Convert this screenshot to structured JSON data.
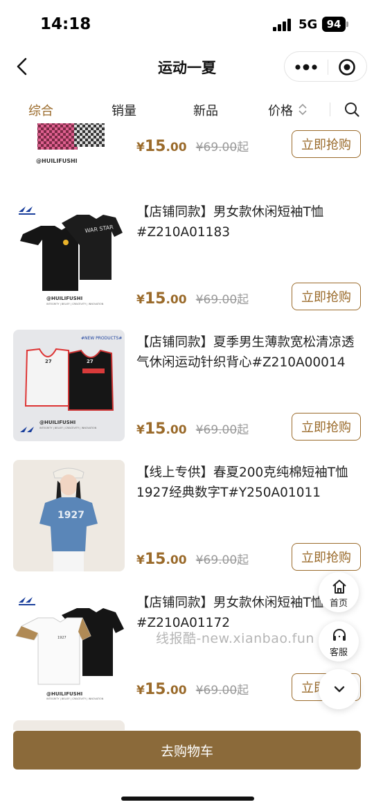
{
  "status_bar": {
    "time": "14:18",
    "network": "5G",
    "battery": "94"
  },
  "nav": {
    "title": "运动一夏"
  },
  "tabs": [
    {
      "label": "综合",
      "active": true
    },
    {
      "label": "销量",
      "active": false
    },
    {
      "label": "新品",
      "active": false
    },
    {
      "label": "价格",
      "active": false
    }
  ],
  "thumb_text": {
    "brand": "@HUILIFUSHI",
    "tagline": "INTEGRITY | BELIEF | CREATIVITY | INNOVATION",
    "new_products": "#NEW PRODUCTS#",
    "jersey_no": "27",
    "shirt_print": "1927"
  },
  "products": [
    {
      "title": "",
      "price_currency": "¥",
      "price_int": "15",
      "price_dec": ".00",
      "original_price": "¥69.00",
      "from_label": "起",
      "buy_label": "立即抢购"
    },
    {
      "title": "【店铺同款】男女款休闲短袖T恤#Z210A01183",
      "price_currency": "¥",
      "price_int": "15",
      "price_dec": ".00",
      "original_price": "¥69.00",
      "from_label": "起",
      "buy_label": "立即抢购"
    },
    {
      "title": "【店铺同款】夏季男生薄款宽松清凉透气休闲运动针织背心#Z210A00014",
      "price_currency": "¥",
      "price_int": "15",
      "price_dec": ".00",
      "original_price": "¥69.00",
      "from_label": "起",
      "buy_label": "立即抢购"
    },
    {
      "title": "【线上专供】春夏200克纯棉短袖T恤1927经典数字T#Y250A01011",
      "price_currency": "¥",
      "price_int": "15",
      "price_dec": ".00",
      "original_price": "¥69.00",
      "from_label": "起",
      "buy_label": "立即抢购"
    },
    {
      "title": "【店铺同款】男女款休闲短袖T恤#Z210A01172",
      "price_currency": "¥",
      "price_int": "15",
      "price_dec": ".00",
      "original_price": "¥69.00",
      "from_label": "起",
      "buy_label": "立即抢购"
    }
  ],
  "floating": {
    "home_label": "首页",
    "service_label": "客服"
  },
  "watermark": "线报酷-new.xianbao.fun",
  "cart_button": "去购物车",
  "colors": {
    "accent": "#9a6a2a",
    "cart_bg": "#8b6a3a"
  }
}
